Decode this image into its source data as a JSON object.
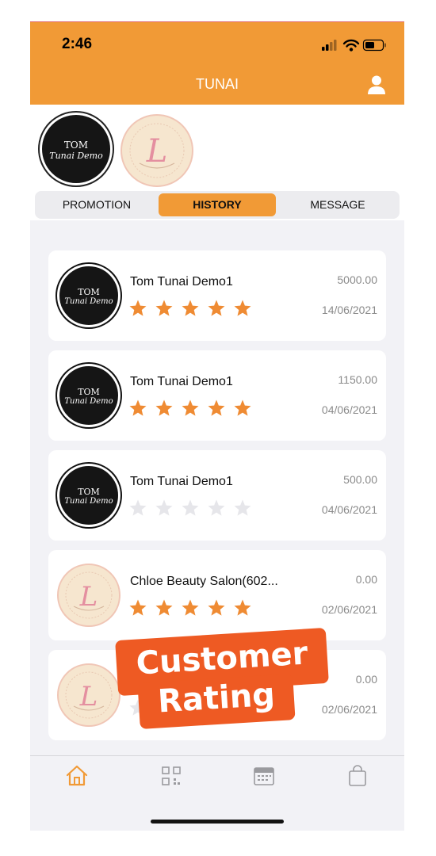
{
  "status_bar": {
    "time": "2:46"
  },
  "header": {
    "title": "TUNAI",
    "profile_icon": "person-icon"
  },
  "merchants": [
    {
      "name_line1": "TOM",
      "name_line2": "Tunai Demo",
      "logo": "tom-logo"
    },
    {
      "logo": "chloe-logo",
      "logo_letter": "L"
    }
  ],
  "tabs": [
    {
      "label": "PROMOTION",
      "active": false
    },
    {
      "label": "HISTORY",
      "active": true
    },
    {
      "label": "MESSAGE",
      "active": false
    }
  ],
  "history": [
    {
      "name": "Tom Tunai Demo1",
      "amount": "5000.00",
      "date": "14/06/2021",
      "rating": 5,
      "logo": "tom",
      "logo_line1": "TOM",
      "logo_line2": "Tunai Demo"
    },
    {
      "name": "Tom Tunai Demo1",
      "amount": "1150.00",
      "date": "04/06/2021",
      "rating": 5,
      "logo": "tom",
      "logo_line1": "TOM",
      "logo_line2": "Tunai Demo"
    },
    {
      "name": "Tom Tunai Demo1",
      "amount": "500.00",
      "date": "04/06/2021",
      "rating": 0,
      "logo": "tom",
      "logo_line1": "TOM",
      "logo_line2": "Tunai Demo"
    },
    {
      "name": "Chloe Beauty Salon(602...",
      "amount": "0.00",
      "date": "02/06/2021",
      "rating": 5,
      "logo": "chloe",
      "logo_letter": "L"
    },
    {
      "name": "",
      "amount": "0.00",
      "date": "02/06/2021",
      "rating": 0,
      "logo": "chloe",
      "logo_letter": "L"
    }
  ],
  "overlay": {
    "line1": "Customer",
    "line2": "Rating"
  },
  "tab_bar": [
    "home-icon",
    "qr-code-icon",
    "calendar-icon",
    "shopping-bag-icon"
  ],
  "colors": {
    "accent": "#f19a36",
    "star_filled": "#ef8b33",
    "star_empty": "#e6e6ea",
    "badge": "#ee5a23"
  }
}
